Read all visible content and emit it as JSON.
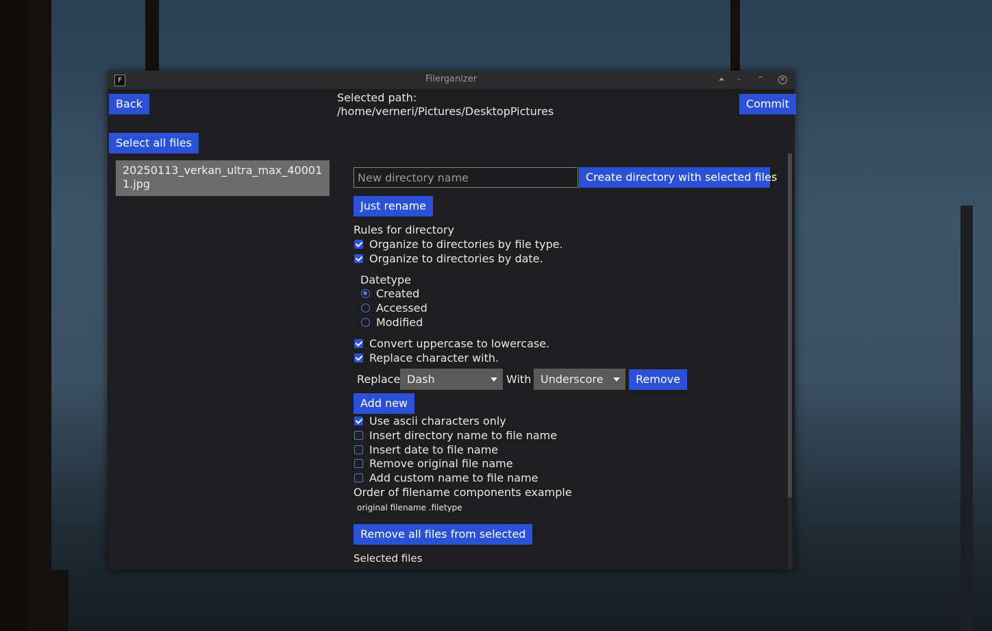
{
  "window": {
    "title": "Filerganizer",
    "app_icon": "F",
    "controls": {
      "shade": "⏶",
      "minimize": "–",
      "maximize": "⌃",
      "close": "×"
    }
  },
  "header": {
    "back_label": "Back",
    "selected_path_label": "Selected path:",
    "selected_path_value": "/home/verneri/Pictures/DesktopPictures",
    "commit_label": "Commit"
  },
  "left": {
    "select_all_label": "Select all files",
    "files": [
      "20250113_verkan_ultra_max_400011.jpg"
    ]
  },
  "right": {
    "new_dir_placeholder": "New directory name",
    "new_dir_value": "",
    "create_dir_label": "Create directory with selected files",
    "just_rename_label": "Just rename",
    "rules_heading": "Rules for directory",
    "rule_file_type": {
      "label": "Organize to directories by file type.",
      "checked": true
    },
    "rule_date": {
      "label": "Organize to directories by date.",
      "checked": true
    },
    "datetype_heading": "Datetype",
    "datetype_options": [
      {
        "label": "Created",
        "selected": true
      },
      {
        "label": "Accessed",
        "selected": false
      },
      {
        "label": "Modified",
        "selected": false
      }
    ],
    "convert_lowercase": {
      "label": "Convert uppercase to lowercase.",
      "checked": true
    },
    "replace_char": {
      "label": "Replace character with.",
      "checked": true
    },
    "replace_row": {
      "replace_label": "Replace",
      "replace_value": "Dash",
      "with_label": "With",
      "with_value": "Underscore",
      "remove_label": "Remove"
    },
    "add_new_label": "Add new",
    "ascii_only": {
      "label": "Use ascii characters only",
      "checked": true
    },
    "insert_dir_name": {
      "label": "Insert directory name to file name",
      "checked": false
    },
    "insert_date": {
      "label": "Insert date to file name",
      "checked": false
    },
    "remove_original": {
      "label": "Remove original file name",
      "checked": false
    },
    "add_custom": {
      "label": "Add custom name to file name",
      "checked": false
    },
    "order_heading": "Order of filename components example",
    "order_example": "original filename .filetype",
    "remove_all_label": "Remove all files from selected",
    "selected_files_heading": "Selected files"
  },
  "colors": {
    "accent": "#2b52d6",
    "window_bg": "#1e1e20",
    "file_item_bg": "#6b6b6b"
  }
}
